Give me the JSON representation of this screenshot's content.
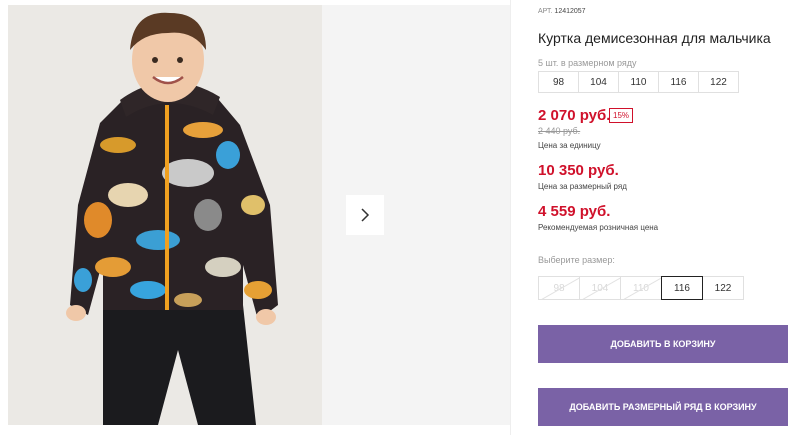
{
  "gallery": {
    "next_icon": "chevron-right-icon"
  },
  "product": {
    "art_label": "АРТ.",
    "art_number": "12412057",
    "title": "Куртка демисезонная для мальчика",
    "row_note": "5 шт. в размерном ряду",
    "row_sizes": [
      "98",
      "104",
      "110",
      "116",
      "122"
    ]
  },
  "pricing": {
    "unit_price": "2 070 руб.",
    "discount": "15%",
    "old_price": "2 440 руб.",
    "unit_label": "Цена за единицу",
    "row_price": "10 350 руб.",
    "row_label": "Цена за размерный ряд",
    "retail_price": "4 559 руб.",
    "retail_label": "Рекомендуемая розничная цена"
  },
  "size_select": {
    "label": "Выберите размер:",
    "options": [
      {
        "size": "98",
        "state": "unavailable"
      },
      {
        "size": "104",
        "state": "unavailable"
      },
      {
        "size": "110",
        "state": "unavailable"
      },
      {
        "size": "116",
        "state": "selected"
      },
      {
        "size": "122",
        "state": "available"
      }
    ]
  },
  "actions": {
    "add_to_cart": "Добавить в корзину",
    "add_row_to_cart": "Добавить размерный ряд в корзину"
  },
  "colors": {
    "accent": "#7a62a6",
    "price_red": "#d0112b"
  }
}
